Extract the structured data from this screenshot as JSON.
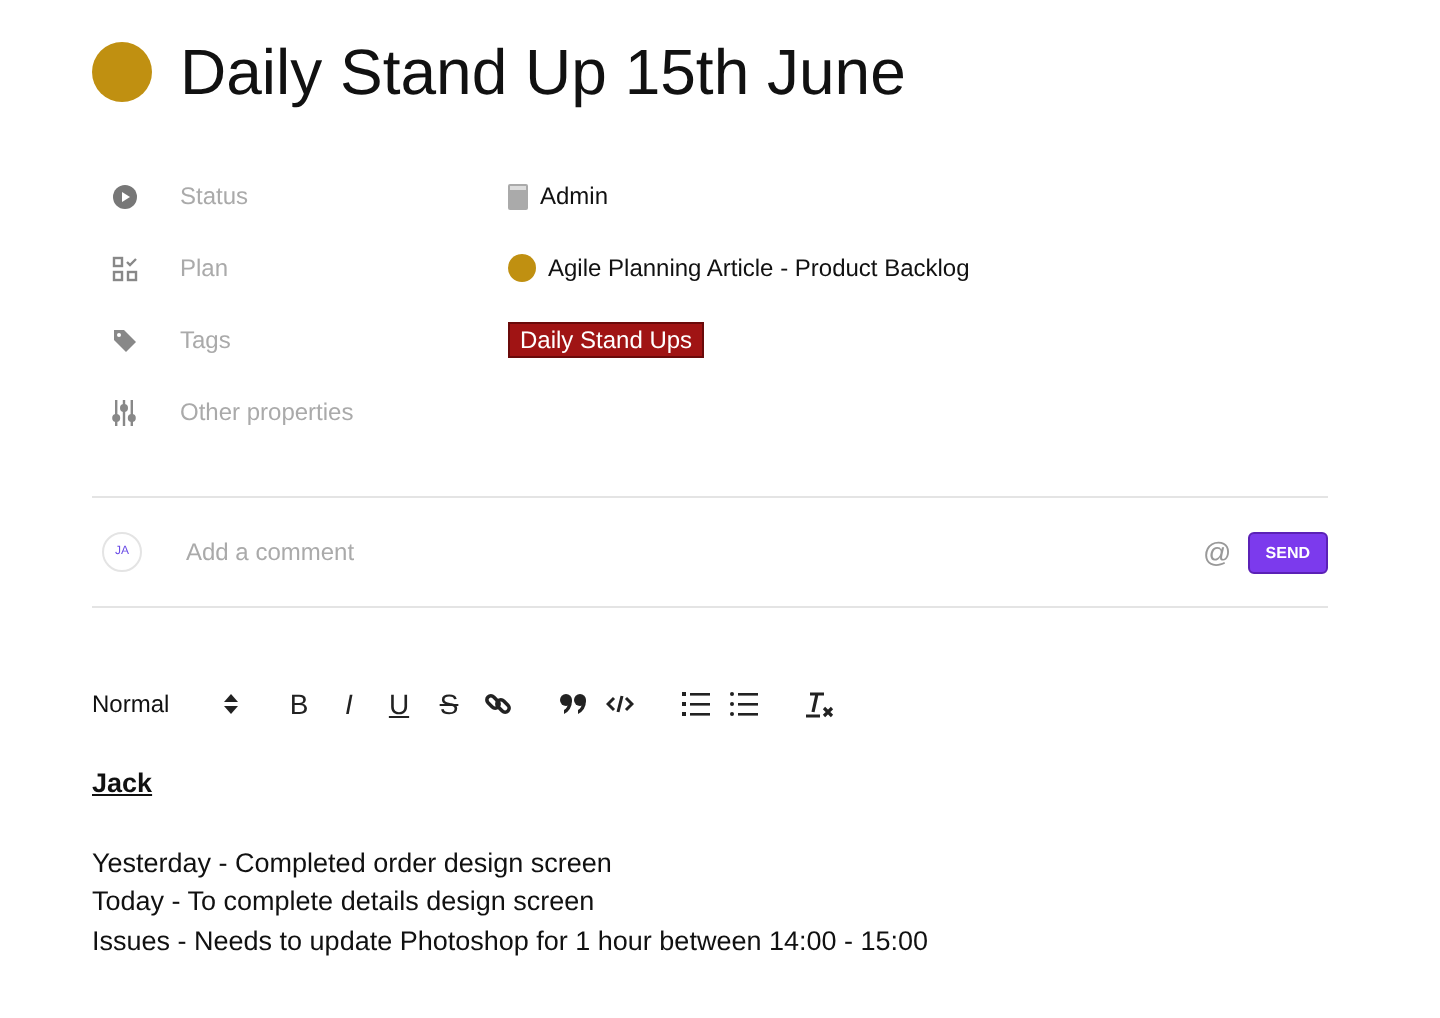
{
  "title": {
    "text": "Daily Stand Up 15th June",
    "color": "#c09011"
  },
  "properties": [
    {
      "kind": "status",
      "label": "Status",
      "value": "Admin"
    },
    {
      "kind": "plan",
      "label": "Plan",
      "value": "Agile Planning Article - Product Backlog",
      "color": "#c09011"
    },
    {
      "kind": "tags",
      "label": "Tags",
      "value": "Daily Stand Ups",
      "color": "#a01414"
    },
    {
      "kind": "other",
      "label": "Other properties"
    }
  ],
  "comment": {
    "avatar": "JA",
    "placeholder": "Add a comment",
    "mention": "@",
    "send": "SEND"
  },
  "toolbar": {
    "format": "Normal",
    "marks": [
      "B",
      "I",
      "U",
      "S"
    ]
  },
  "body": {
    "heading": "Jack",
    "lines": [
      "Yesterday - Completed order design screen",
      "Today - To complete details design screen",
      "Issues - Needs to update Photoshop for 1 hour between 14:00 - 15:00"
    ]
  }
}
